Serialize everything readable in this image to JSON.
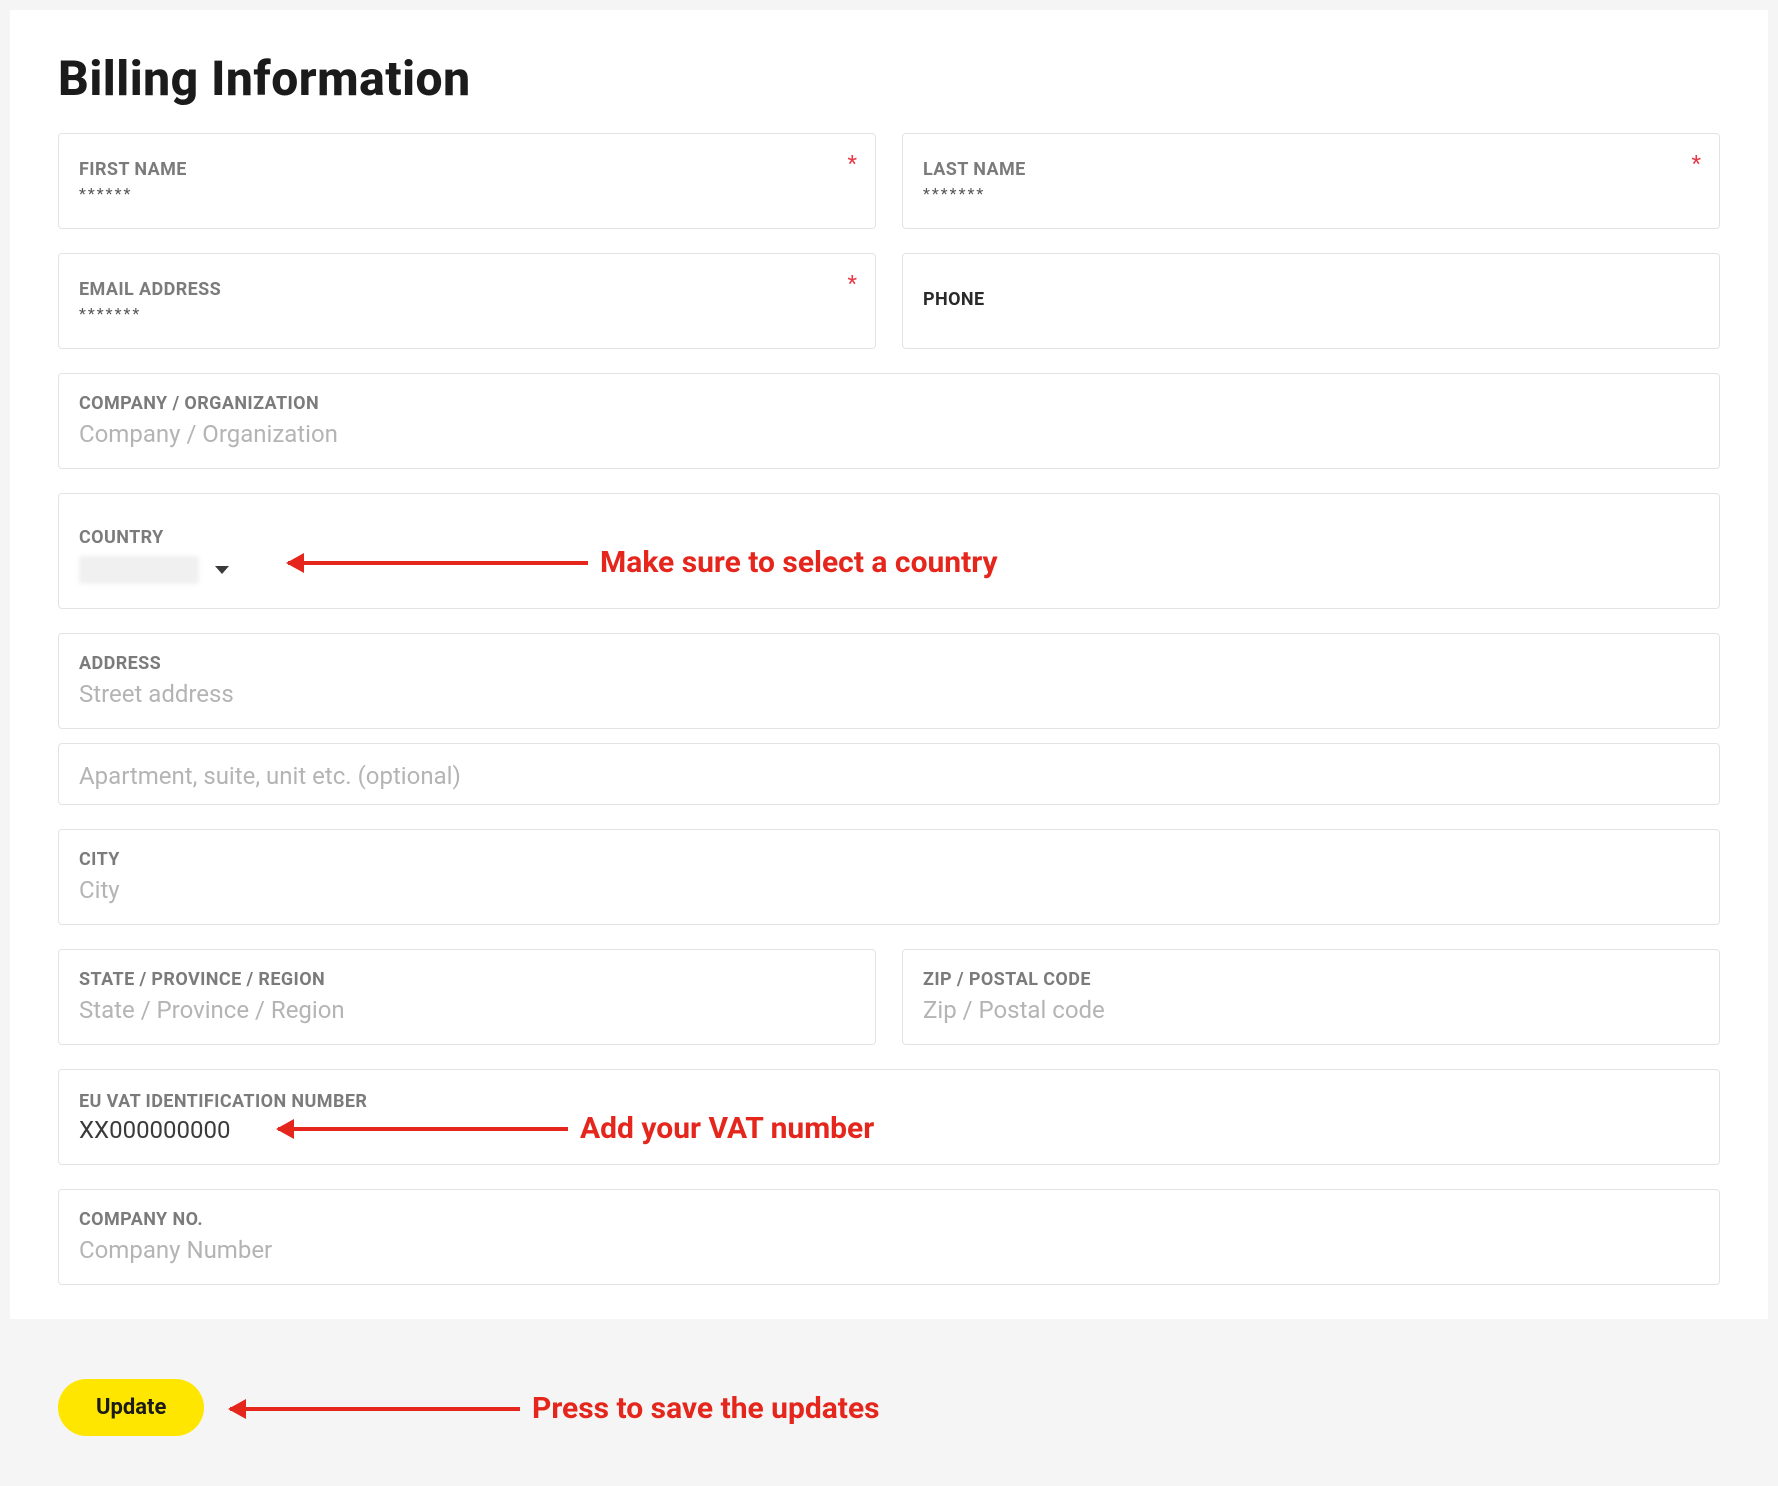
{
  "title": "Billing Information",
  "fields": {
    "first_name": {
      "label": "FIRST NAME",
      "value": "******",
      "required": true
    },
    "last_name": {
      "label": "LAST NAME",
      "value": "*******",
      "required": true
    },
    "email": {
      "label": "EMAIL ADDRESS",
      "value": "*******",
      "required": true
    },
    "phone": {
      "label": "PHONE"
    },
    "company": {
      "label": "COMPANY / ORGANIZATION",
      "placeholder": "Company / Organization"
    },
    "country": {
      "label": "COUNTRY"
    },
    "address": {
      "label": "ADDRESS",
      "placeholder": "Street address"
    },
    "address2": {
      "placeholder": "Apartment, suite, unit etc. (optional)"
    },
    "city": {
      "label": "CITY",
      "placeholder": "City"
    },
    "state": {
      "label": "STATE / PROVINCE / REGION",
      "placeholder": "State / Province / Region"
    },
    "zip": {
      "label": "ZIP / POSTAL CODE",
      "placeholder": "Zip / Postal code"
    },
    "vat": {
      "label": "EU VAT IDENTIFICATION NUMBER",
      "value": "XX000000000"
    },
    "company_no": {
      "label": "COMPANY NO.",
      "placeholder": "Company Number"
    }
  },
  "buttons": {
    "update": "Update"
  },
  "annotations": {
    "country": "Make sure to select a country",
    "vat": "Add your VAT number",
    "update": "Press to save the updates"
  },
  "required_mark": "*"
}
